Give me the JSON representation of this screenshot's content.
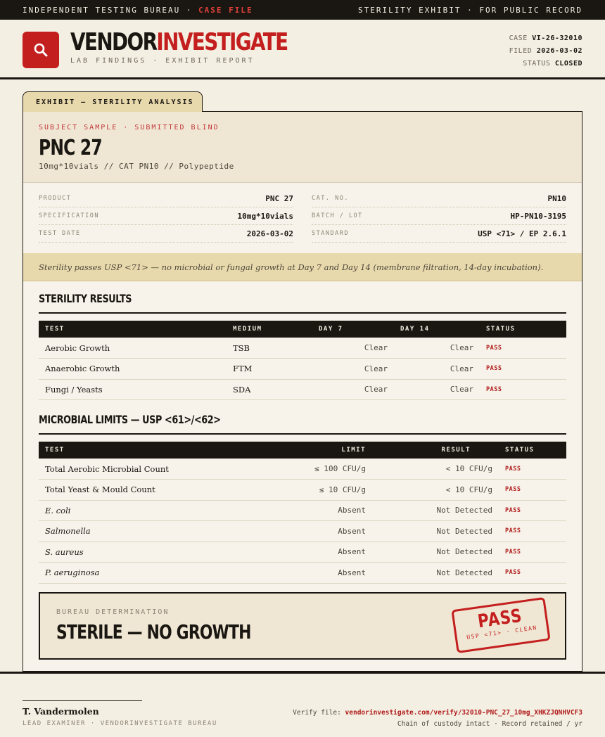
{
  "topbar": {
    "left_prefix": "INDEPENDENT TESTING BUREAU ·",
    "left_accent": "CASE FILE",
    "right": "STERILITY EXHIBIT · FOR PUBLIC RECORD"
  },
  "header": {
    "brand_part1": "VENDOR",
    "brand_part2": "INVESTIGATE",
    "subtitle": "LAB FINDINGS · EXHIBIT REPORT",
    "case_label": "CASE",
    "case_value": "VI-26-32010",
    "filed_label": "FILED",
    "filed_value": "2026-03-02",
    "status_label": "STATUS",
    "status_value": "CLOSED",
    "logo_icon": "magnifier-icon"
  },
  "tab": {
    "label": "EXHIBIT — STERILITY ANALYSIS"
  },
  "subject": {
    "kicker": "SUBJECT SAMPLE · SUBMITTED BLIND",
    "name": "PNC 27",
    "description": "10mg*10vials  //  CAT PN10  //  Polypeptide"
  },
  "specs": {
    "left": [
      {
        "key": "PRODUCT",
        "value": "PNC 27"
      },
      {
        "key": "SPECIFICATION",
        "value": "10mg*10vials"
      },
      {
        "key": "TEST DATE",
        "value": "2026-03-02"
      }
    ],
    "right": [
      {
        "key": "CAT. NO.",
        "value": "PN10"
      },
      {
        "key": "BATCH / LOT",
        "value": "HP-PN10-3195"
      },
      {
        "key": "STANDARD",
        "value": "USP <71> / EP 2.6.1"
      }
    ]
  },
  "summary": "Sterility passes USP <71> — no microbial or fungal growth at Day 7 and Day 14 (membrane filtration, 14-day incubation).",
  "sterility": {
    "title": "STERILITY RESULTS",
    "headers": [
      "TEST",
      "MEDIUM",
      "DAY 7",
      "DAY 14",
      "STATUS"
    ],
    "rows": [
      {
        "test": "Aerobic Growth",
        "medium": "TSB",
        "day7": "Clear",
        "day14": "Clear",
        "status": "PASS"
      },
      {
        "test": "Anaerobic Growth",
        "medium": "FTM",
        "day7": "Clear",
        "day14": "Clear",
        "status": "PASS"
      },
      {
        "test": "Fungi / Yeasts",
        "medium": "SDA",
        "day7": "Clear",
        "day14": "Clear",
        "status": "PASS"
      }
    ]
  },
  "microbial": {
    "title": "MICROBIAL LIMITS — USP <61>/<62>",
    "headers": [
      "TEST",
      "LIMIT",
      "RESULT",
      "STATUS"
    ],
    "rows": [
      {
        "test": "Total Aerobic Microbial Count",
        "limit": "≤ 100 CFU/g",
        "result": "< 10 CFU/g",
        "status": "PASS"
      },
      {
        "test": "Total Yeast & Mould Count",
        "limit": "≤ 10 CFU/g",
        "result": "< 10 CFU/g",
        "status": "PASS"
      },
      {
        "test": "E. coli",
        "limit": "Absent",
        "result": "Not Detected",
        "status": "PASS"
      },
      {
        "test": "Salmonella",
        "limit": "Absent",
        "result": "Not Detected",
        "status": "PASS"
      },
      {
        "test": "S. aureus",
        "limit": "Absent",
        "result": "Not Detected",
        "status": "PASS"
      },
      {
        "test": "P. aeruginosa",
        "limit": "Absent",
        "result": "Not Detected",
        "status": "PASS"
      }
    ]
  },
  "determination": {
    "label": "BUREAU DETERMINATION",
    "value": "STERILE — NO GROWTH",
    "stamp_main": "PASS",
    "stamp_sub": "USP <71> · CLEAN"
  },
  "footer": {
    "signer": "T. Vandermolen",
    "role": "LEAD EXAMINER · VENDORINVESTIGATE BUREAU",
    "verify_label": "Verify file:",
    "verify_link": "vendorinvestigate.com/verify/32010-PNC_27_10mg_XHKZJQNHVCF3",
    "custody": "Chain of custody intact · Record retained / yr"
  },
  "colors": {
    "accent": "#c41f1f",
    "ink": "#1a1712",
    "paper": "#f4efe3",
    "highlight": "#e8d9ac"
  }
}
